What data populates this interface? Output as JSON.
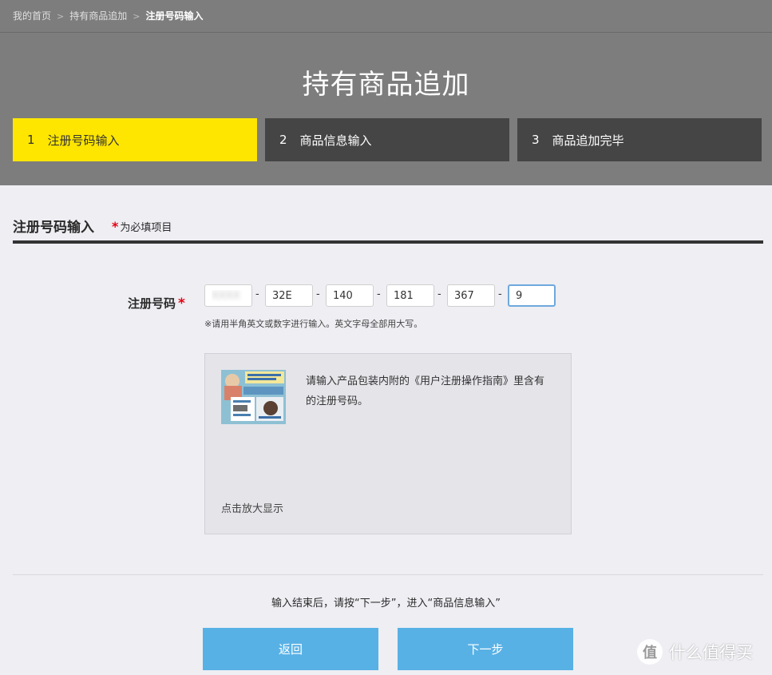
{
  "breadcrumb": {
    "items": [
      "我的首页",
      "持有商品追加",
      "注册号码输入"
    ],
    "separator": ">"
  },
  "header": {
    "title": "持有商品追加"
  },
  "steps": [
    {
      "num": "1",
      "label": "注册号码输入",
      "active": true
    },
    {
      "num": "2",
      "label": "商品信息输入",
      "active": false
    },
    {
      "num": "3",
      "label": "商品追加完毕",
      "active": false
    }
  ],
  "section": {
    "title": "注册号码输入",
    "required_star": "*",
    "required_text": "为必填项目"
  },
  "form": {
    "label": "注册号码",
    "required_star": "*",
    "dash": "-",
    "code_fields": [
      {
        "value": "XXXX",
        "blurred": true
      },
      {
        "value": "32E"
      },
      {
        "value": "140"
      },
      {
        "value": "181"
      },
      {
        "value": "367"
      },
      {
        "value": "9",
        "focused": true
      }
    ],
    "hint": "※请用半角英文或数字进行输入。英文字母全部用大写。"
  },
  "guide": {
    "description": "请输入产品包装内附的《用户注册操作指南》里含有的注册号码。",
    "zoom_label": "点击放大显示"
  },
  "footer": {
    "instruction": "输入结束后，请按“下一步”，进入“商品信息输入”",
    "back_label": "返回",
    "next_label": "下一步"
  },
  "watermark": {
    "badge": "值",
    "text": "什么值得买"
  },
  "colors": {
    "header_bg": "#7d7d7d",
    "step_active": "#ffe600",
    "step_inactive": "#454545",
    "button": "#58b1e5",
    "required": "#e60012",
    "page_bg": "#eeeef3"
  }
}
